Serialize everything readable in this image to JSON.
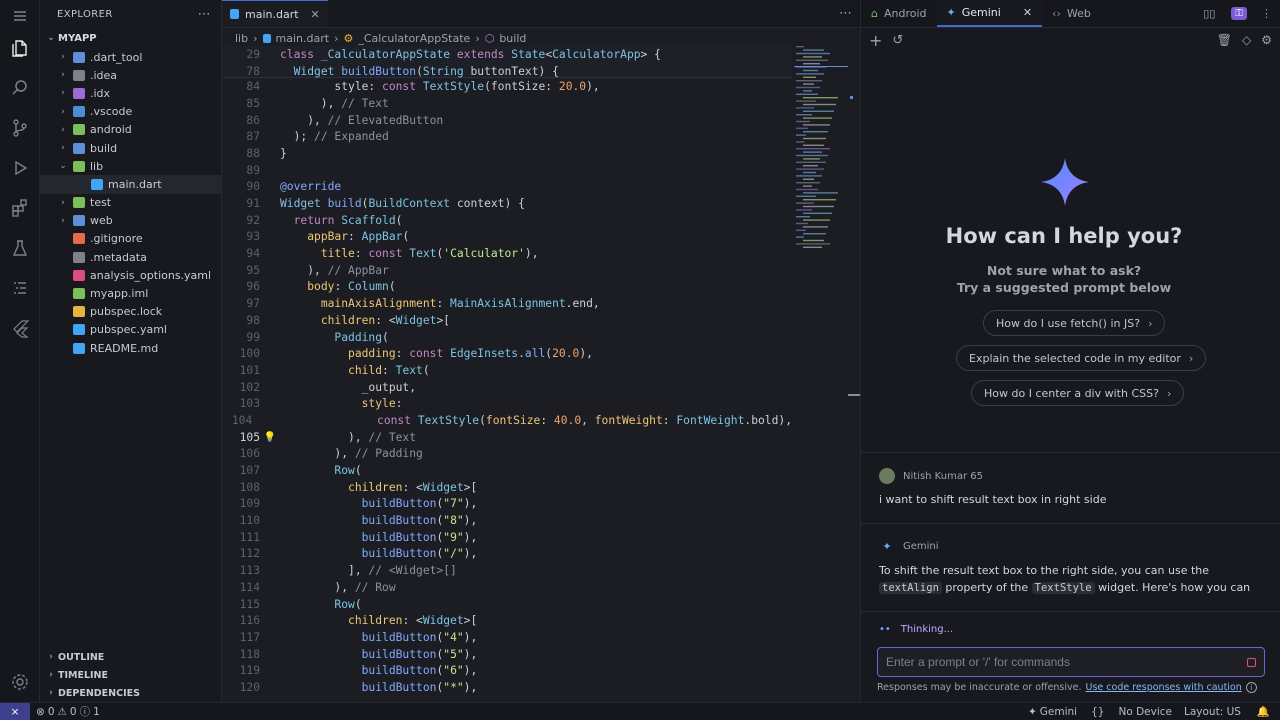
{
  "sidebar": {
    "title": "EXPLORER",
    "root": "MYAPP",
    "items": [
      {
        "label": ".dart_tool",
        "chev": "›",
        "color": "#5f8fd6"
      },
      {
        "label": ".idea",
        "chev": "›",
        "color": "#7d818c"
      },
      {
        "label": ".idx",
        "chev": "›",
        "color": "#9b6cd8"
      },
      {
        "label": ".vscode",
        "chev": "›",
        "color": "#4b8fd6"
      },
      {
        "label": "android",
        "chev": "›",
        "color": "#7cbf5a"
      },
      {
        "label": "build",
        "chev": "›",
        "color": "#5f8fd6"
      },
      {
        "label": "lib",
        "chev": "⌄",
        "color": "#7cbf5a"
      },
      {
        "label": "main.dart",
        "chev": "",
        "color": "#42a5f5"
      },
      {
        "label": "test",
        "chev": "›",
        "color": "#7cbf5a"
      },
      {
        "label": "web",
        "chev": "›",
        "color": "#5f8fd6"
      },
      {
        "label": ".gitignore",
        "chev": "",
        "color": "#e06c4a"
      },
      {
        "label": ".metadata",
        "chev": "",
        "color": "#7d818c"
      },
      {
        "label": "analysis_options.yaml",
        "chev": "",
        "color": "#d94e7a"
      },
      {
        "label": "myapp.iml",
        "chev": "",
        "color": "#7cbf5a"
      },
      {
        "label": "pubspec.lock",
        "chev": "",
        "color": "#e5b53c"
      },
      {
        "label": "pubspec.yaml",
        "chev": "",
        "color": "#42a5f5"
      },
      {
        "label": "README.md",
        "chev": "",
        "color": "#42a5f5"
      }
    ],
    "panels": [
      "OUTLINE",
      "TIMELINE",
      "DEPENDENCIES"
    ]
  },
  "editor": {
    "tab": "main.dart",
    "breadcrumbs": [
      "lib",
      "main.dart",
      "_CalculatorAppState",
      "build"
    ],
    "sticky_lines": [
      {
        "n": "29",
        "html": "<span class='kw'>class</span> <span class='ty'>_CalculatorAppState</span> <span class='kw'>extends</span> <span class='ty'>State</span>&lt;<span class='ty'>CalculatorApp</span>&gt; {"
      },
      {
        "n": "78",
        "html": "  <span class='ty'>Widget</span> <span class='fn'>buildButton</span>(<span class='ty'>String</span> buttonText) {"
      }
    ],
    "lines": [
      {
        "n": "84",
        "html": "        style: <span class='kw'>const</span> <span class='ty'>TextStyle</span>(fontSize: <span class='nm'>20.0</span>),"
      },
      {
        "n": "85",
        "html": "      ), <span class='cm'>// Text</span>"
      },
      {
        "n": "86",
        "html": "    ), <span class='cm'>// ElevatedButton</span>"
      },
      {
        "n": "87",
        "html": "  ); <span class='cm'>// Expanded</span>"
      },
      {
        "n": "88",
        "html": "}"
      },
      {
        "n": "89",
        "html": ""
      },
      {
        "n": "90",
        "html": "<span class='an'>@override</span>"
      },
      {
        "n": "91",
        "html": "<span class='ty'>Widget</span> <span class='fn'>build</span>(<span class='ty'>BuildContext</span> context) {"
      },
      {
        "n": "92",
        "html": "  <span class='kw'>return</span> <span class='ty'>Scaffold</span>("
      },
      {
        "n": "93",
        "html": "    <span class='pr'>appBar</span>: <span class='ty'>AppBar</span>("
      },
      {
        "n": "94",
        "html": "      <span class='pr'>title</span>: <span class='kw'>const</span> <span class='ty'>Text</span>(<span class='st'>'Calculator'</span>),"
      },
      {
        "n": "95",
        "html": "    ), <span class='cm'>// AppBar</span>"
      },
      {
        "n": "96",
        "html": "    <span class='pr'>body</span>: <span class='ty'>Column</span>("
      },
      {
        "n": "97",
        "html": "      <span class='pr'>mainAxisAlignment</span>: <span class='ty'>MainAxisAlignment</span>.end,"
      },
      {
        "n": "98",
        "html": "      <span class='pr'>children</span>: &lt;<span class='ty'>Widget</span>&gt;["
      },
      {
        "n": "99",
        "html": "        <span class='ty'>Padding</span>("
      },
      {
        "n": "100",
        "html": "          <span class='pr'>padding</span>: <span class='kw'>const</span> <span class='ty'>EdgeInsets</span>.<span class='fn'>all</span>(<span class='nm'>20.0</span>),"
      },
      {
        "n": "101",
        "html": "          <span class='pr'>child</span>: <span class='ty'>Text</span>("
      },
      {
        "n": "102",
        "html": "            _output,"
      },
      {
        "n": "103",
        "html": "            <span class='pr'>style</span>:"
      },
      {
        "n": "104",
        "html": "                <span class='kw'>const</span> <span class='ty'>TextStyle</span>(<span class='pr'>fontSize</span>: <span class='nm'>40.0</span>, <span class='pr'>fontWeight</span>: <span class='ty'>FontWeight</span>.bold),"
      },
      {
        "n": "105",
        "html": "          ), <span class='cm'>// Text</span>"
      },
      {
        "n": "106",
        "html": "        ), <span class='cm'>// Padding</span>"
      },
      {
        "n": "107",
        "html": "        <span class='ty'>Row</span>("
      },
      {
        "n": "108",
        "html": "          <span class='pr'>children</span>: &lt;<span class='ty'>Widget</span>&gt;["
      },
      {
        "n": "109",
        "html": "            <span class='fn'>buildButton</span>(<span class='st'>\"7\"</span>),"
      },
      {
        "n": "110",
        "html": "            <span class='fn'>buildButton</span>(<span class='st'>\"8\"</span>),"
      },
      {
        "n": "111",
        "html": "            <span class='fn'>buildButton</span>(<span class='st'>\"9\"</span>),"
      },
      {
        "n": "112",
        "html": "            <span class='fn'>buildButton</span>(<span class='st'>\"/\"</span>),"
      },
      {
        "n": "113",
        "html": "          ], <span class='cm'>// &lt;Widget&gt;[]</span>"
      },
      {
        "n": "114",
        "html": "        ), <span class='cm'>// Row</span>"
      },
      {
        "n": "115",
        "html": "        <span class='ty'>Row</span>("
      },
      {
        "n": "116",
        "html": "          <span class='pr'>children</span>: &lt;<span class='ty'>Widget</span>&gt;["
      },
      {
        "n": "117",
        "html": "            <span class='fn'>buildButton</span>(<span class='st'>\"4\"</span>),"
      },
      {
        "n": "118",
        "html": "            <span class='fn'>buildButton</span>(<span class='st'>\"5\"</span>),"
      },
      {
        "n": "119",
        "html": "            <span class='fn'>buildButton</span>(<span class='st'>\"6\"</span>),"
      },
      {
        "n": "120",
        "html": "            <span class='fn'>buildButton</span>(<span class='st'>\"*\"</span>),"
      }
    ],
    "current_line": "105"
  },
  "gemini": {
    "tabs": [
      "Android",
      "Gemini",
      "Web"
    ],
    "welcome_title": "How can I help you?",
    "welcome_sub_1": "Not sure what to ask?",
    "welcome_sub_2": "Try a suggested prompt below",
    "prompts": [
      "How do I use fetch() in JS?",
      "Explain the selected code in my editor",
      "How do I center a div with CSS?"
    ],
    "user_name": "Nitish Kumar 65",
    "user_message": "i want to shift result text box in right side",
    "assistant_name": "Gemini",
    "assistant_part1": "To shift the result text box to the right side, you can use the",
    "assistant_code1": "textAlign",
    "assistant_part2": "property of the",
    "assistant_code2": "TextStyle",
    "assistant_part3": "widget. Here's how you can",
    "thinking": "Thinking...",
    "input_placeholder": "Enter a prompt or '/' for commands",
    "disclaimer": "Responses may be inaccurate or offensive.",
    "disclaimer_link": "Use code responses with caution"
  },
  "status": {
    "errors": "0",
    "warnings": "0",
    "info": "1",
    "gemini": "Gemini",
    "device": "No Device",
    "layout": "Layout: US"
  },
  "colors": {
    "accent": "#3d6bd8",
    "input_border": "#6f62d8",
    "link": "#8ab4f8"
  }
}
